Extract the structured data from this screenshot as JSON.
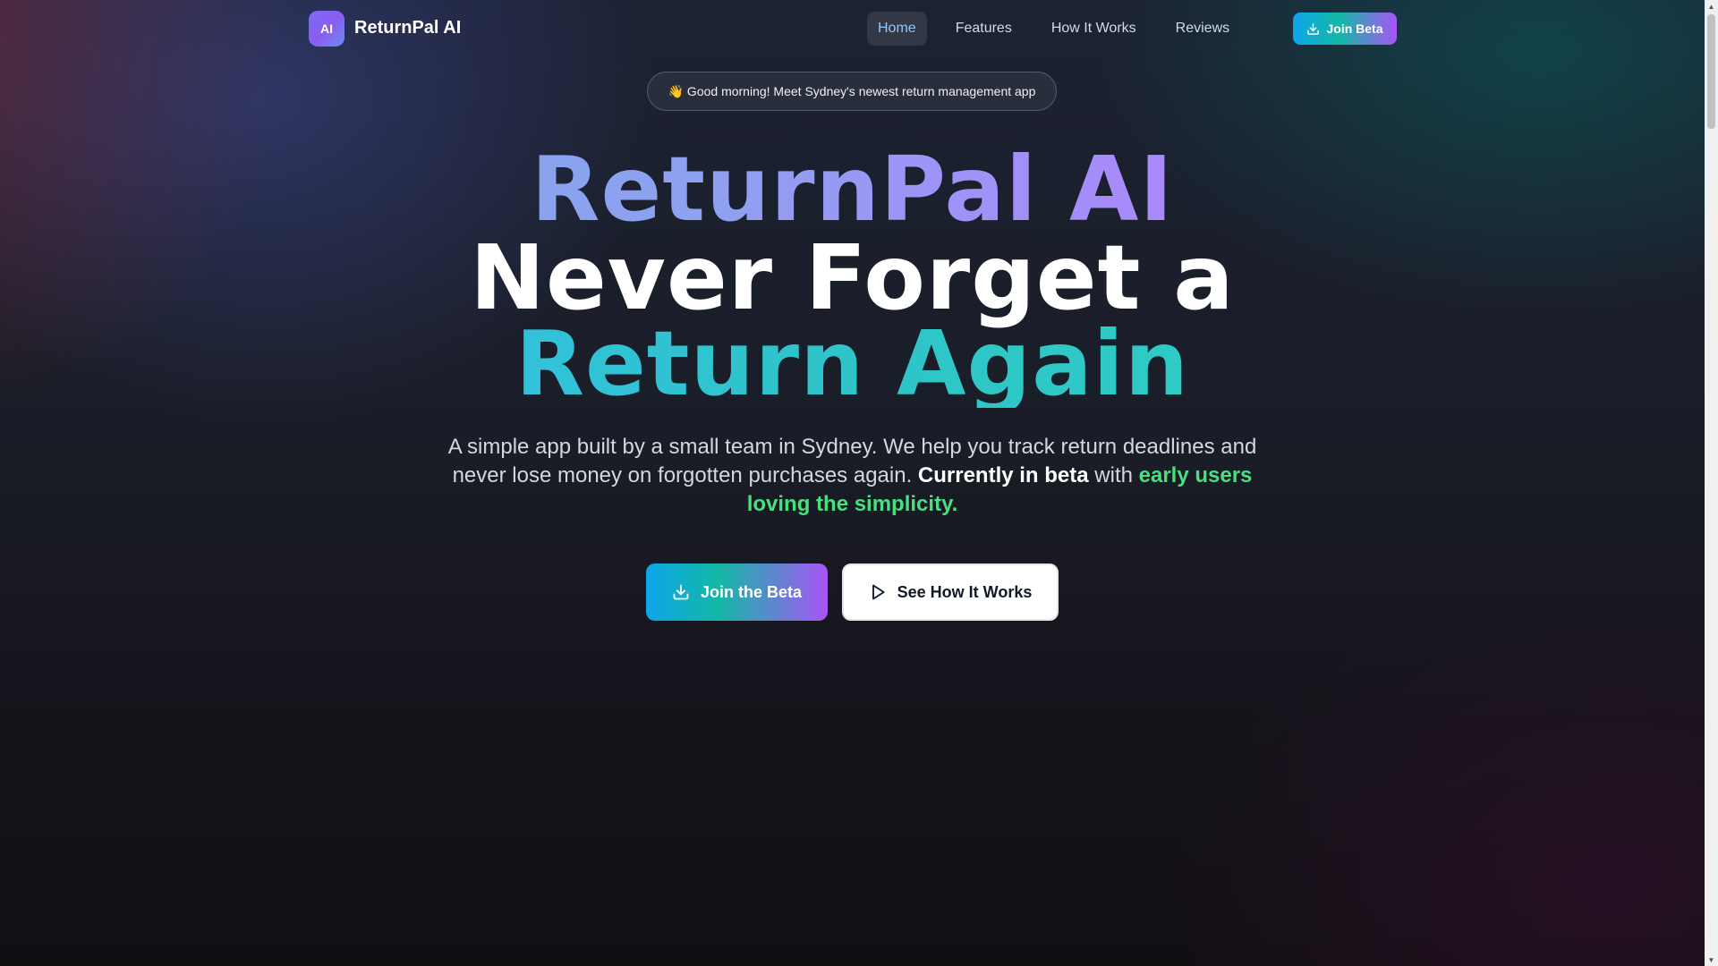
{
  "nav": {
    "logo_text": "AI",
    "brand": "ReturnPal AI",
    "links": [
      {
        "label": "Home",
        "active": true
      },
      {
        "label": "Features"
      },
      {
        "label": "How It Works"
      },
      {
        "label": "Reviews"
      }
    ],
    "cta_label": "Join Beta",
    "cta_icon": "download-icon"
  },
  "hero": {
    "announcement": "👋 Good morning! Meet Sydney's newest return management app",
    "headline_line1": "ReturnPal AI",
    "headline_line2": "Never Forget a",
    "headline_line3": "Return Again",
    "subtitle_part1": "A simple app built by a small team in Sydney. We help you track return deadlines and never lose money on forgotten purchases again.",
    "subtitle_bold": "Currently in beta",
    "subtitle_with": "with",
    "subtitle_green": "early users loving the simplicity.",
    "primary_cta": "Join the Beta",
    "primary_cta_icon": "download-icon",
    "secondary_cta": "See How It Works",
    "secondary_cta_icon": "play-icon"
  },
  "colors": {
    "accent_cyan": "#0ea5e9",
    "accent_teal": "#14b8a6",
    "accent_purple": "#a855f7",
    "highlight_green": "#4ade80",
    "nav_active": "#93c5fd"
  }
}
